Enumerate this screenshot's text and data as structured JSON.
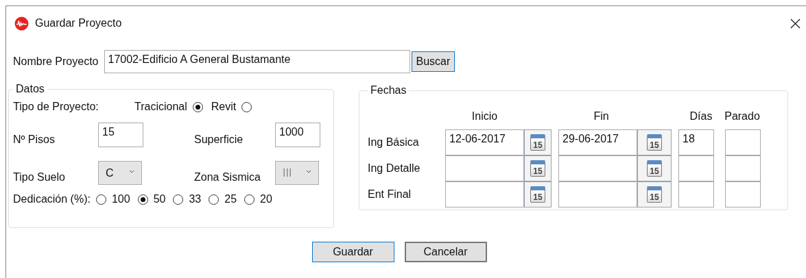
{
  "window": {
    "title": "Guardar Proyecto"
  },
  "project": {
    "label": "Nombre Proyecto",
    "value": "17002-Edificio A General Bustamante",
    "button": "Buscar"
  },
  "datos": {
    "title": "Datos",
    "type_label": "Tipo de Proyecto:",
    "type_options": [
      {
        "label": "Tracicional",
        "selected": true
      },
      {
        "label": "Revit",
        "selected": false
      }
    ],
    "pisos_label": "Nº Pisos",
    "pisos": "15",
    "superficie_label": "Superficie",
    "superficie": "1000",
    "suelo_label": "Tipo Suelo",
    "suelo": {
      "value": "C",
      "disabled": false
    },
    "zona_label": "Zona Sismica",
    "zona": {
      "value": "III",
      "disabled": true
    },
    "dedicacion_label": "Dedicación (%):",
    "dedicacion_options": [
      {
        "label": "100",
        "selected": false
      },
      {
        "label": "50",
        "selected": true
      },
      {
        "label": "33",
        "selected": false
      },
      {
        "label": "25",
        "selected": false
      },
      {
        "label": "20",
        "selected": false
      }
    ]
  },
  "fechas": {
    "title": "Fechas",
    "columns": [
      "Inicio",
      "Fin",
      "Días",
      "Parado"
    ],
    "rows": [
      {
        "label": "Ing Básica",
        "inicio": {
          "value": "12-06-2017",
          "calendar": "15"
        },
        "fin": {
          "value": "29-06-2017",
          "calendar": "15"
        },
        "dias": "18"
      },
      {
        "label": "Ing Detalle",
        "inicio": {
          "calendar": "15"
        },
        "fin": {
          "calendar": "15"
        }
      },
      {
        "label": "Ent Final",
        "inicio": {
          "calendar": "15"
        },
        "fin": {
          "calendar": "15"
        }
      }
    ]
  },
  "buttons": [
    {
      "label": "Guardar",
      "default": true
    },
    {
      "label": "Cancelar",
      "default": false
    }
  ]
}
